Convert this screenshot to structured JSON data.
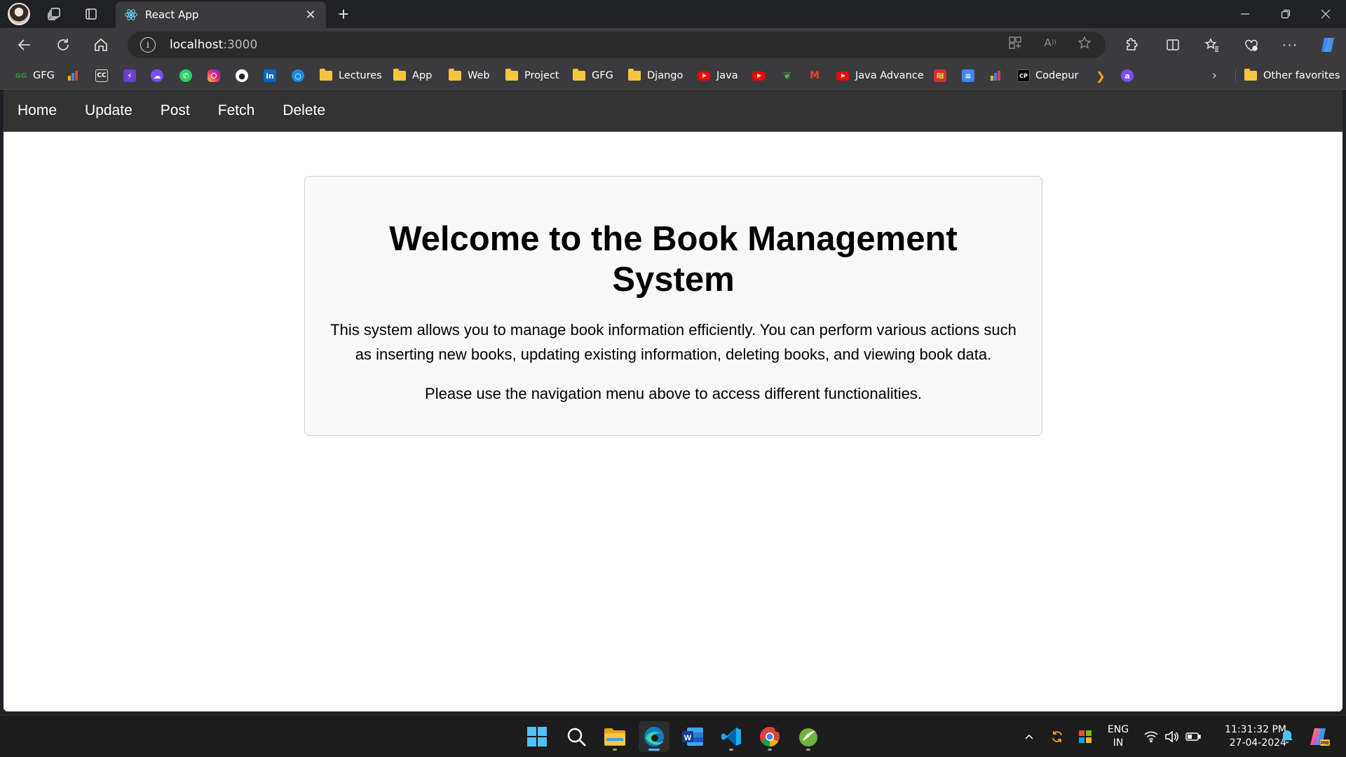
{
  "browser": {
    "tab": {
      "title": "React App"
    },
    "address": {
      "host": "localhost",
      "port": ":3000"
    },
    "bookmarks": [
      {
        "label": "GFG",
        "icon": "gfg-icon",
        "color": "#2f8d46"
      },
      {
        "label": "",
        "icon": "chart-icon"
      },
      {
        "label": "",
        "icon": "cc-icon"
      },
      {
        "label": "",
        "icon": "bolt-icon"
      },
      {
        "label": "",
        "icon": "cloud-icon"
      },
      {
        "label": "",
        "icon": "whatsapp-icon"
      },
      {
        "label": "",
        "icon": "instagram-icon"
      },
      {
        "label": "",
        "icon": "github-icon"
      },
      {
        "label": "",
        "icon": "linkedin-icon"
      },
      {
        "label": "",
        "icon": "circle-icon"
      },
      {
        "label": "Lectures",
        "icon": "folder-icon"
      },
      {
        "label": "App",
        "icon": "folder-icon"
      },
      {
        "label": "Web",
        "icon": "folder-icon"
      },
      {
        "label": "Project",
        "icon": "folder-icon"
      },
      {
        "label": "GFG",
        "icon": "folder-icon"
      },
      {
        "label": "Django",
        "icon": "folder-icon"
      },
      {
        "label": "Java",
        "icon": "youtube-icon"
      },
      {
        "label": "",
        "icon": "youtube-icon"
      },
      {
        "label": "",
        "icon": "leaf-icon"
      },
      {
        "label": "",
        "icon": "gmail-icon"
      },
      {
        "label": "Java Advance",
        "icon": "youtube-icon"
      },
      {
        "label": "",
        "icon": "bank-icon"
      },
      {
        "label": "",
        "icon": "docs-icon"
      },
      {
        "label": "",
        "icon": "chart-icon"
      },
      {
        "label": "Codepur",
        "icon": "codepen-icon"
      },
      {
        "label": "",
        "icon": "chevron-right-icon"
      },
      {
        "label": "",
        "icon": "a-icon"
      }
    ],
    "other_favorites": "Other favorites"
  },
  "app": {
    "nav": [
      {
        "label": "Home"
      },
      {
        "label": "Update"
      },
      {
        "label": "Post"
      },
      {
        "label": "Fetch"
      },
      {
        "label": "Delete"
      }
    ],
    "card": {
      "heading_line1": "Welcome to the Book Management",
      "heading_line2": "System",
      "paragraph1": "This system allows you to manage book information efficiently. You can perform various actions such as inserting new books, updating existing information, deleting books, and viewing book data.",
      "paragraph2": "Please use the navigation menu above to access different functionalities."
    }
  },
  "taskbar": {
    "lang_line1": "ENG",
    "lang_line2": "IN",
    "time": "11:31:32 PM",
    "date": "27-04-2024"
  }
}
